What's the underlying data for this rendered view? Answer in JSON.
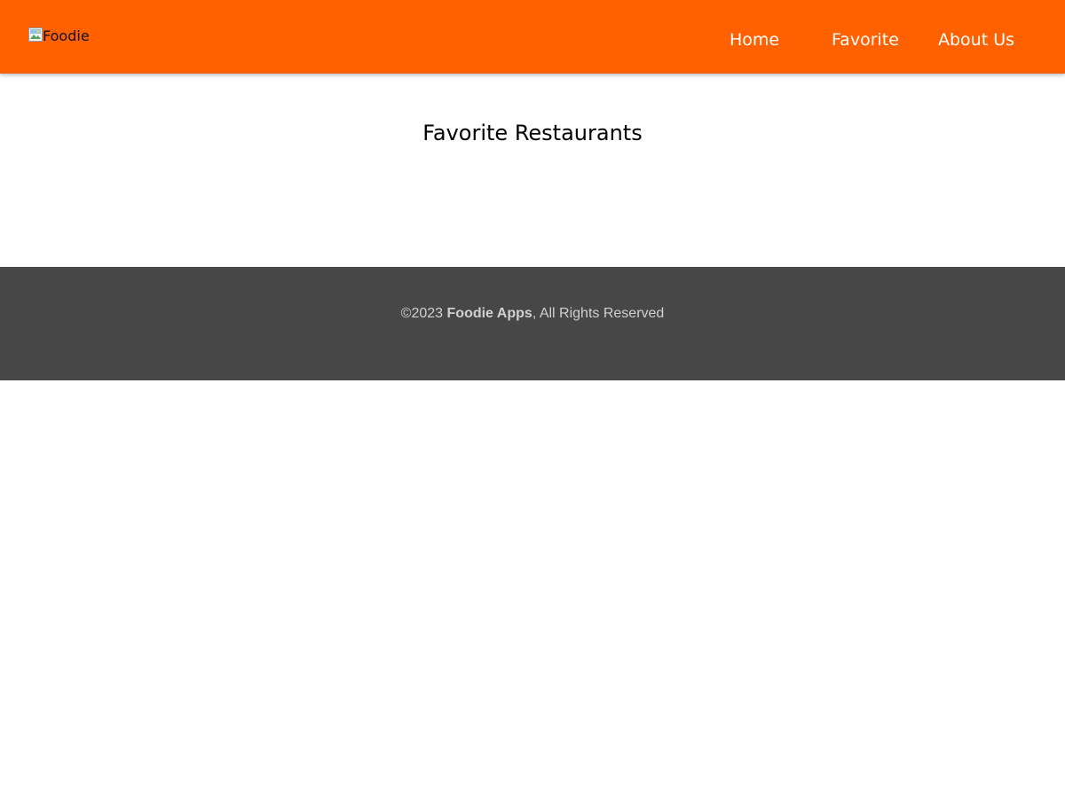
{
  "theme": {
    "header_color": "#FF6000",
    "footer_color": "#474747"
  },
  "header": {
    "logo_alt": "Foodie",
    "logo_icon": "broken-image-icon",
    "nav": [
      {
        "label": "Home"
      },
      {
        "label": "Favorite"
      },
      {
        "label": "About Us"
      }
    ]
  },
  "main": {
    "title": "Favorite Restaurants"
  },
  "footer": {
    "copyright": "©2023",
    "brand": "Foodie Apps",
    "suffix": ", All Rights Reserved"
  }
}
